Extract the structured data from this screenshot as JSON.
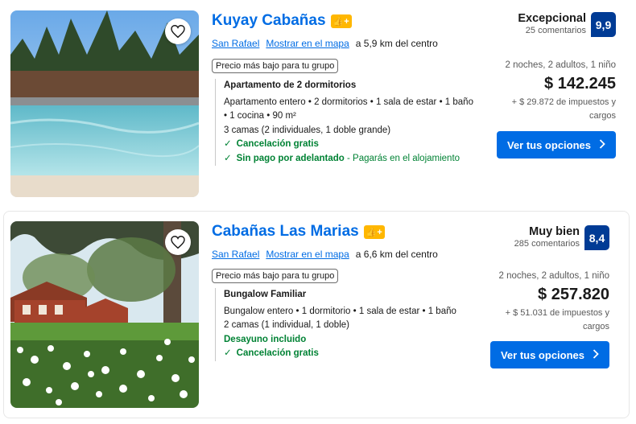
{
  "properties": [
    {
      "name": "Kuyay Cabañas",
      "badge": "👍+",
      "town": "San Rafael",
      "map_link": "Mostrar en el mapa",
      "distance": "a 5,9 km del centro",
      "low_price_tag": "Precio más bajo para tu grupo",
      "unit_name": "Apartamento de 2 dormitorios",
      "unit_lines": [
        "Apartamento entero • 2 dormitorios • 1 sala de estar • 1 baño",
        "• 1 cocina • 90 m²",
        "3 camas (2 individuales, 1 doble grande)"
      ],
      "perk_1": "Cancelación gratis",
      "perk_2": "Sin pago por adelantado",
      "perk_2_note": "- Pagarás en el alojamiento",
      "review_word": "Excepcional",
      "review_count": "25 comentarios",
      "score": "9,9",
      "nights": "2 noches, 2 adultos, 1 niño",
      "price": "$ 142.245",
      "taxes": "+ $ 29.872 de impuestos y cargos",
      "cta": "Ver tus opciones"
    },
    {
      "name": "Cabañas Las Marias",
      "badge": "👍+",
      "town": "San Rafael",
      "map_link": "Mostrar en el mapa",
      "distance": "a 6,6 km del centro",
      "low_price_tag": "Precio más bajo para tu grupo",
      "unit_name": "Bungalow Familiar",
      "unit_lines": [
        "Bungalow entero • 1 dormitorio • 1 sala de estar • 1 baño",
        "2 camas (1 individual, 1 doble)"
      ],
      "meal": "Desayuno incluido",
      "perk_1": "Cancelación gratis",
      "review_word": "Muy bien",
      "review_count": "285 comentarios",
      "score": "8,4",
      "nights": "2 noches, 2 adultos, 1 niño",
      "price": "$ 257.820",
      "taxes": "+ $ 51.031 de impuestos y cargos",
      "cta": "Ver tus opciones"
    }
  ],
  "icons": {
    "favorite": "heart-icon",
    "check": "check-icon",
    "chevron": "chevron-right-icon"
  },
  "colors": {
    "link_blue": "#006ce4",
    "score_blue": "#003b95",
    "genius_yellow": "#ffb700",
    "green": "#008234"
  }
}
